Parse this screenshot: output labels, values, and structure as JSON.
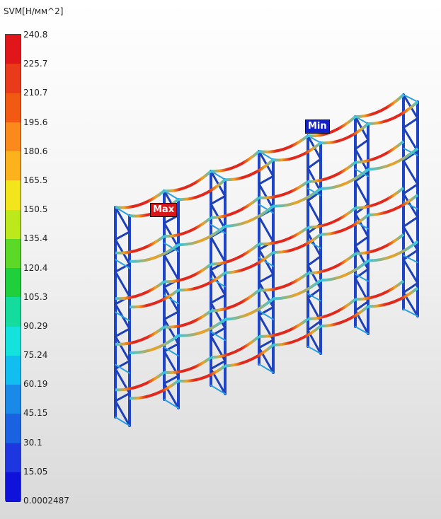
{
  "legend": {
    "title": "SVM[Н/мм^2]",
    "ticks": [
      "240.8",
      "225.7",
      "210.7",
      "195.6",
      "180.6",
      "165.5",
      "150.5",
      "135.4",
      "120.4",
      "105.3",
      "90.29",
      "75.24",
      "60.19",
      "45.15",
      "30.1",
      "15.05",
      "0.0002487"
    ],
    "colors": [
      "#e0161a",
      "#ea3a1c",
      "#f25a14",
      "#fb8a1d",
      "#fbb21c",
      "#f3e51c",
      "#bde81b",
      "#5cd927",
      "#1fcf3b",
      "#14dc9c",
      "#13e3dc",
      "#12bdf0",
      "#1a8ae8",
      "#1b62e2",
      "#1e36e0",
      "#0f12d8"
    ]
  },
  "markers": {
    "max": "Max",
    "min": "Min"
  },
  "model_colors": {
    "column": "#1e44c8",
    "column_alt": "#2a9fe0",
    "brace": "#1d3fb8",
    "beam_hot": "#e0281c",
    "beam_mid": "#f0a020",
    "beam_cool": "#30c8e8"
  }
}
